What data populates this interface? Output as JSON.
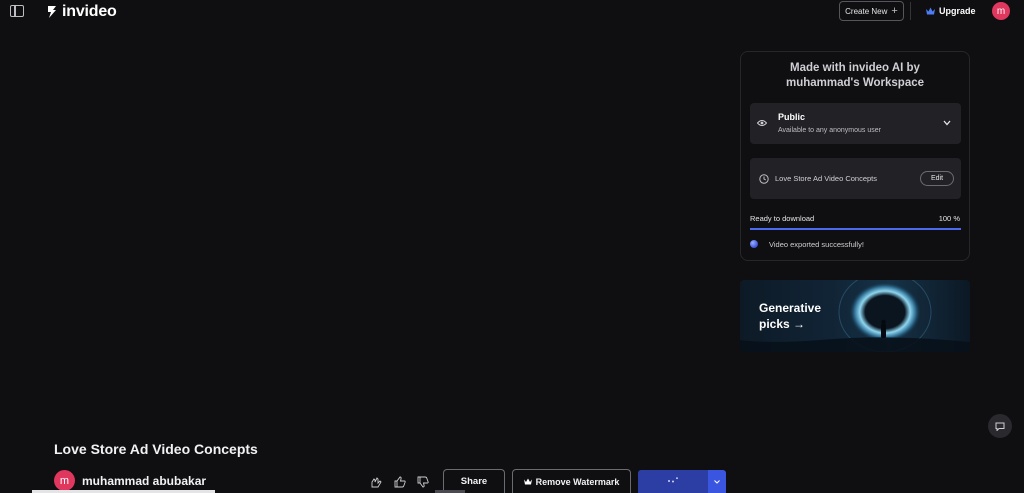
{
  "app": {
    "logo_text": "invideo"
  },
  "header": {
    "create_new_label": "Create New",
    "upgrade_label": "Upgrade",
    "avatar_initial": "m"
  },
  "panel": {
    "title_line1": "Made with invideo AI by",
    "title_line2": "muhammad's Workspace",
    "visibility": {
      "title": "Public",
      "subtitle": "Available to any anonymous user"
    },
    "project": {
      "name": "Love Store Ad Video Concepts",
      "edit_label": "Edit"
    },
    "export": {
      "ready_label": "Ready to download",
      "progress_text": "100 %",
      "progress": 1.0,
      "message": "Video exported successfully!"
    }
  },
  "generative": {
    "line1": "Generative",
    "line2": "picks →"
  },
  "video": {
    "title": "Love Store Ad Video Concepts",
    "author_initial": "m",
    "author_name": "muhammad abubakar"
  },
  "actions": {
    "share_label": "Share",
    "remove_watermark_label": "Remove Watermark"
  },
  "colors": {
    "accent": "#4d69f0",
    "avatar": "#e0375f",
    "download": "#2c3ea3"
  }
}
